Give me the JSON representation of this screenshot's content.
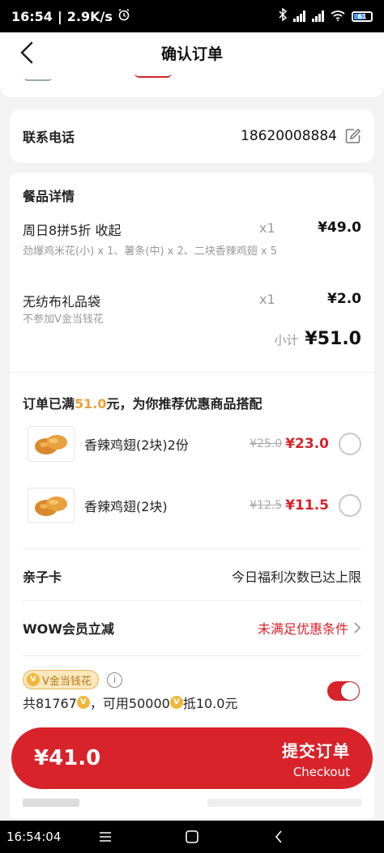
{
  "status": {
    "time": "16:54",
    "speed": "2.9K/s",
    "battery": "61"
  },
  "nav": {
    "title": "确认订单"
  },
  "contact": {
    "label": "联系电话",
    "phone": "18620008884"
  },
  "details": {
    "title": "餐品详情",
    "items": [
      {
        "name": "周日8拼5折  收起",
        "qty": "x1",
        "price": "¥49.0",
        "desc": "劲爆鸡米花(小) x 1、薯条(中) x 2、二块香辣鸡翅 x 5"
      },
      {
        "name": "无纺布礼品袋",
        "qty": "x1",
        "price": "¥2.0",
        "desc": "不参加V金当钱花"
      }
    ],
    "subtotal_label": "小计",
    "subtotal_value": "¥51.0"
  },
  "recommend": {
    "title_prefix": "订单已满",
    "title_amount": "51.0",
    "title_suffix": "元，为你推荐优惠商品搭配",
    "items": [
      {
        "name": "香辣鸡翅(2块)2份",
        "old_price": "¥25.0",
        "new_price": "¥23.0"
      },
      {
        "name": "香辣鸡翅(2块)",
        "old_price": "¥12.5",
        "new_price": "¥11.5"
      }
    ]
  },
  "family_card": {
    "label": "亲子卡",
    "value": "今日福利次数已达上限"
  },
  "wow": {
    "label": "WOW会员立减",
    "value": "未满足优惠条件"
  },
  "vgold": {
    "badge": "V金当钱花",
    "total_prefix": "共81767",
    "usable": "，可用50000",
    "deduct": "抵10.0元",
    "info": "i",
    "coin": "V"
  },
  "checkout": {
    "total": "¥41.0",
    "button": "提交订单",
    "button_sub": "Checkout"
  },
  "sysbar": {
    "time": "16:54:04"
  },
  "colors": {
    "brand": "#d8232a",
    "gold": "#e8a33a"
  }
}
